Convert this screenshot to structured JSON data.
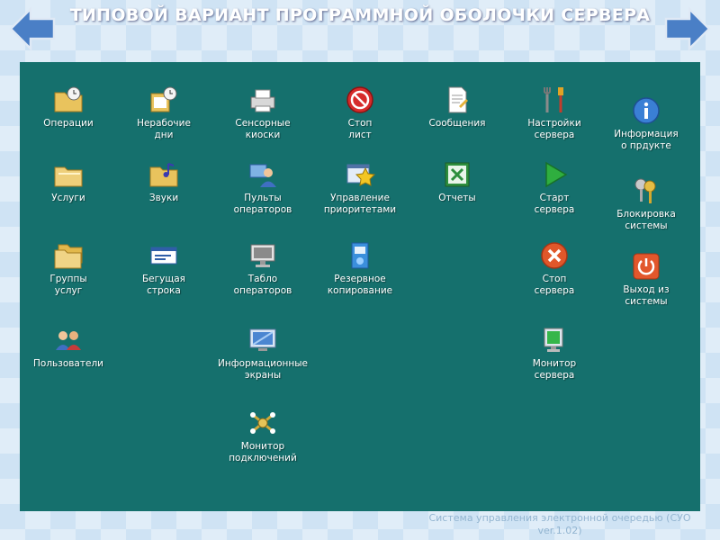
{
  "slide": {
    "title": "ТИПОВОЙ ВАРИАНТ ПРОГРАММНОЙ ОБОЛОЧКИ СЕРВЕРА",
    "footer_line1": "Система управления электронной очередью (СУО",
    "footer_line2": "ver.1.02)"
  },
  "desktop": {
    "background_color": "#15706d",
    "icons": {
      "operations": "Операции",
      "holidays": "Нерабочие\nдни",
      "kiosks": "Сенсорные\nкиоски",
      "stop_list": "Стоп\nлист",
      "messages": "Сообщения",
      "server_settings": "Настройки\nсервера",
      "product_info": "Информация\nо прдукте",
      "services": "Услуги",
      "sounds": "Звуки",
      "operator_panels": "Пульты\nоператоров",
      "priority_mgmt": "Управление\nприоритетами",
      "reports": "Отчеты",
      "start_server": "Старт\nсервера",
      "lock_system": "Блокировка\nсистемы",
      "service_groups": "Группы\nуслуг",
      "ticker": "Бегущая\nстрока",
      "operator_board": "Табло\nоператоров",
      "backup": "Резервное\nкопирование",
      "stop_server": "Стоп\nсервера",
      "exit_system": "Выход из\nсистемы",
      "users": "Пользователи",
      "info_screens": "Информационные\nэкраны",
      "server_monitor": "Монитор\nсервера",
      "connection_monitor": "Монитор\nподключений"
    }
  }
}
